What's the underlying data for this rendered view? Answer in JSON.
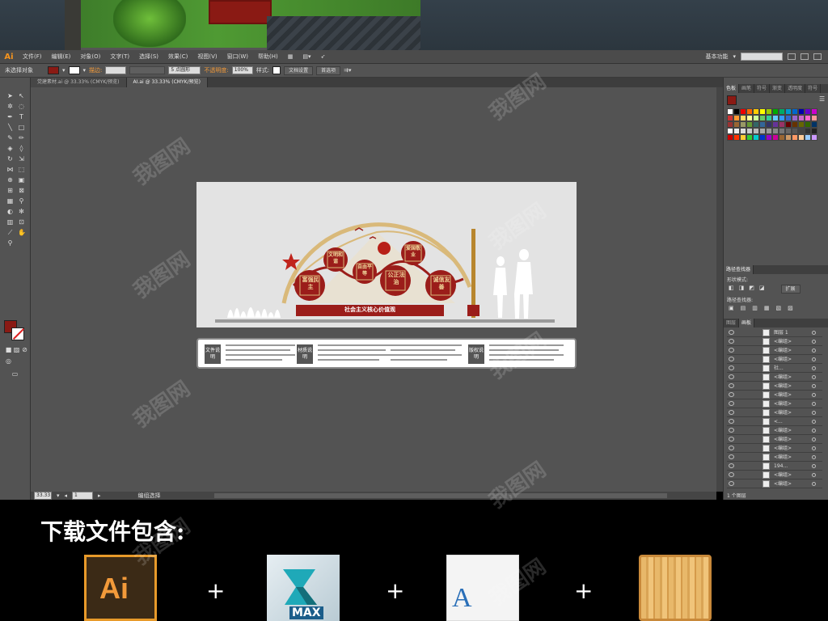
{
  "app": {
    "logo": "Ai",
    "menu": [
      "文件(F)",
      "编辑(E)",
      "对象(O)",
      "文字(T)",
      "选择(S)",
      "效果(C)",
      "视图(V)",
      "窗口(W)",
      "帮助(H)"
    ],
    "workspace": "基本功能"
  },
  "control_bar": {
    "selection_label": "未选择对象",
    "stroke_label": "描边:",
    "brush_label": "5 点圆形",
    "opacity_label": "不透明度:",
    "opacity_value": "100%",
    "style_label": "样式:",
    "doc_setup": "文档设置",
    "preferences": "首选项",
    "fill_color": "#8a1a14"
  },
  "tabs": [
    {
      "label": "党建素材.ai @ 33.33% (CMYK/预览)",
      "active": false
    },
    {
      "label": "AI.ai @ 33.33% (CMYK/预览)",
      "active": true
    }
  ],
  "status": {
    "zoom": "33.33",
    "page": "1",
    "tool": "编组选择"
  },
  "artwork": {
    "title": "社会主义核心价值观",
    "values": [
      "富强民主",
      "文明和谐",
      "自由平等",
      "公正法治",
      "爱国敬业",
      "诚信友善"
    ],
    "note_headers": [
      "文件说明",
      "材质说明",
      "版权说明"
    ],
    "colors": {
      "red": "#9b1d1a",
      "gold": "#d9b97a",
      "board": "#e3e3e3"
    }
  },
  "panels": {
    "swatch_tabs": [
      "色板",
      "画笔",
      "符号",
      "渐变",
      "透明度",
      "符号"
    ],
    "pathfinder_title": "路径查找器",
    "shape_modes": "形状模式:",
    "pathfinders": "路径查找器:",
    "expand": "扩展",
    "layer_tabs": [
      "图层",
      "画板"
    ],
    "layers": [
      {
        "name": "图层 1"
      },
      {
        "name": "<编组>"
      },
      {
        "name": "<编组>"
      },
      {
        "name": "<编组>"
      },
      {
        "name": "社..."
      },
      {
        "name": "<编组>"
      },
      {
        "name": "<编组>"
      },
      {
        "name": "<编组>"
      },
      {
        "name": "<编组>"
      },
      {
        "name": "<编组>"
      },
      {
        "name": "<..."
      },
      {
        "name": "<编组>"
      },
      {
        "name": "<编组>"
      },
      {
        "name": "<编组>"
      },
      {
        "name": "<编组>"
      },
      {
        "name": "194..."
      },
      {
        "name": "<编组>"
      },
      {
        "name": "<编组>"
      }
    ],
    "layer_count": "1 个图层"
  },
  "download": {
    "title": "下载文件包含:",
    "items": [
      "Ai",
      "MAX",
      "A",
      "wood-texture"
    ],
    "plus": "+"
  },
  "watermark": "我图网"
}
